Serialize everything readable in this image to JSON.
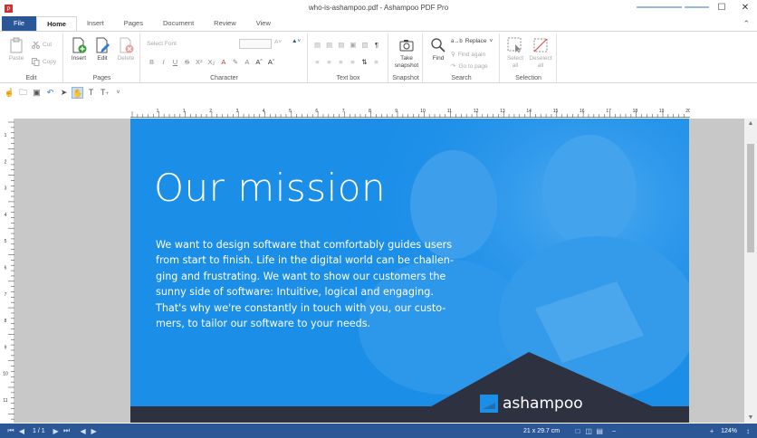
{
  "window": {
    "title": "who-is-ashampoo.pdf - Ashampoo PDF Pro",
    "controls": {
      "minimize": "─",
      "maximize": "☐",
      "close": "✕"
    }
  },
  "ribbon_tabs": [
    {
      "label": "File"
    },
    {
      "label": "Home"
    },
    {
      "label": "Insert"
    },
    {
      "label": "Pages"
    },
    {
      "label": "Document"
    },
    {
      "label": "Review"
    },
    {
      "label": "View"
    }
  ],
  "ribbon": {
    "edit": {
      "group_label": "Edit",
      "paste": "Paste",
      "cut": "Cut",
      "copy": "Copy"
    },
    "pages": {
      "group_label": "Pages",
      "insert": "Insert",
      "edit": "Edit",
      "delete": "Delete"
    },
    "character": {
      "group_label": "Character",
      "font_placeholder": "Select Font"
    },
    "textbox": {
      "group_label": "Text box"
    },
    "snapshot": {
      "group_label": "Snapshot",
      "take_line1": "Take",
      "take_line2": "snapshot"
    },
    "search": {
      "group_label": "Search",
      "find": "Find",
      "replace": "Replace",
      "find_again": "Find again",
      "goto_page": "Go to page"
    },
    "selection": {
      "group_label": "Selection",
      "select_all_line1": "Select",
      "select_all_line2": "all",
      "deselect_all_line1": "Deselect",
      "deselect_all_line2": "all"
    }
  },
  "ruler": {
    "h_numbers": [
      "1",
      "1",
      "2",
      "3",
      "4",
      "5",
      "6",
      "7",
      "8",
      "9",
      "10",
      "11",
      "12",
      "13",
      "14",
      "15",
      "16",
      "17",
      "18",
      "19",
      "20"
    ],
    "v_numbers": [
      "1",
      "2",
      "3",
      "4",
      "5",
      "6",
      "7",
      "8",
      "9",
      "10",
      "11",
      "12"
    ]
  },
  "document": {
    "heading": "Our mission",
    "body_lines": [
      "We want to design software that comfortably guides users",
      "from start to finish. Life in the digital world can be challen-",
      "ging and frustrating. We want to show our customers the",
      "sunny side of software: Intuitive, logical and engaging.",
      "That's why we're constantly in touch with you, our custo-",
      "mers, to tailor our software to your needs."
    ],
    "logo_text": "ashampoo",
    "page_color": "#1b8ee8"
  },
  "status_bar": {
    "page_indicator": "1 / 1",
    "page_size": "21 x 29.7 cm",
    "zoom": "124%",
    "zoom_fraction": 0.62
  },
  "colors": {
    "accent": "#2b5797",
    "page_blue": "#1b8ee8",
    "footer_dark": "#2d3140"
  }
}
